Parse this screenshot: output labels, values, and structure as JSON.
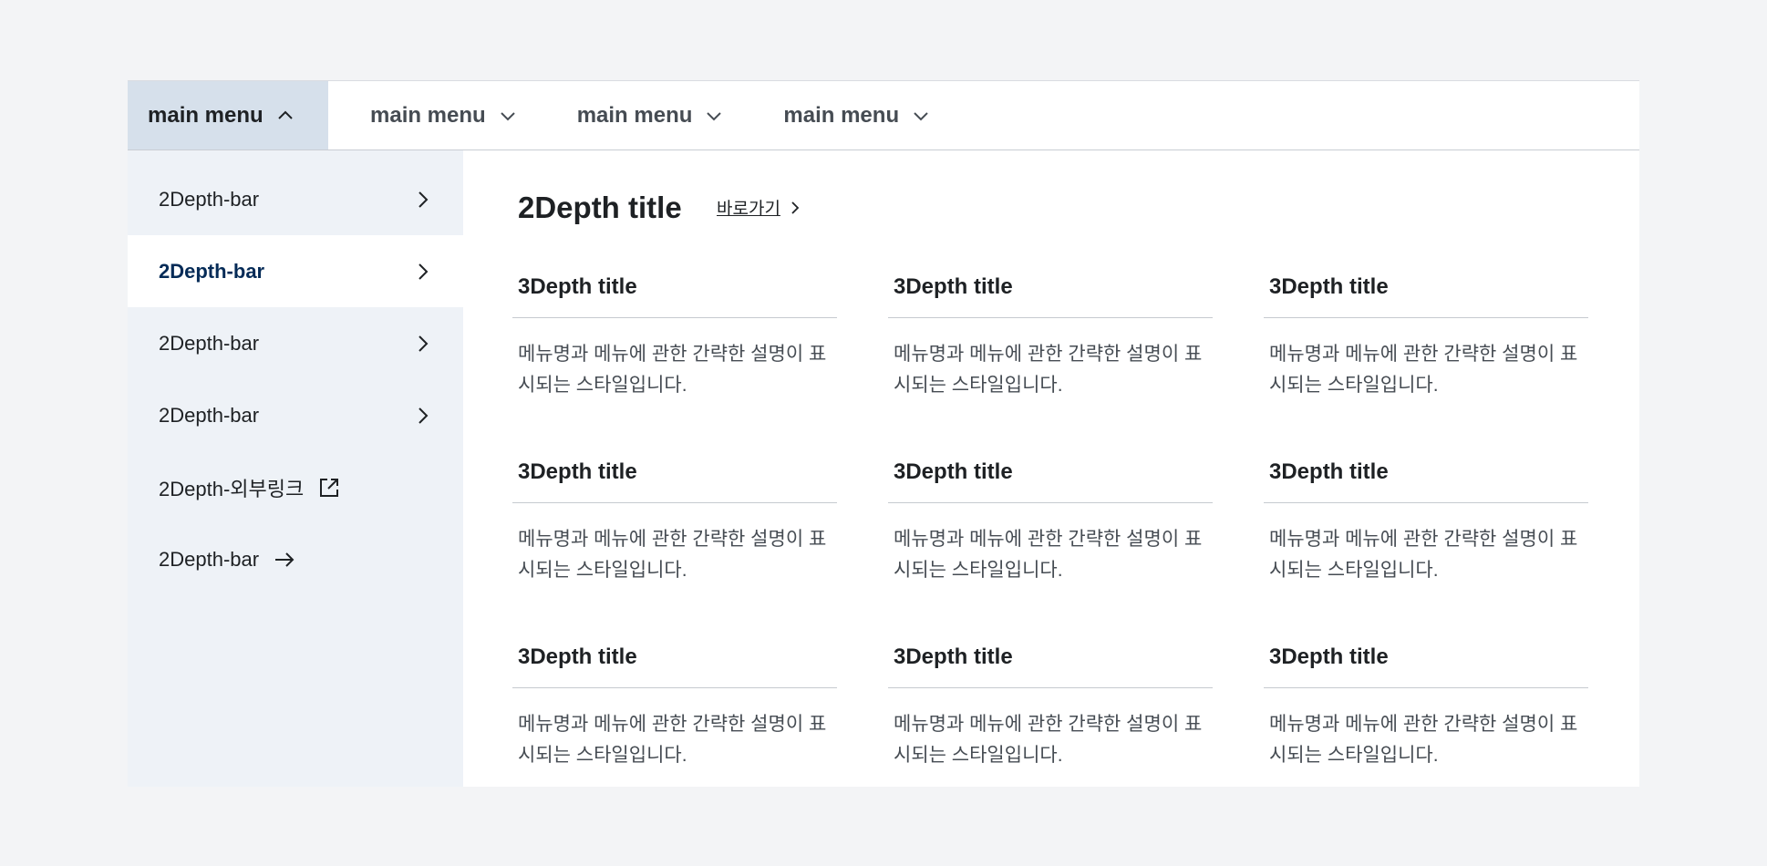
{
  "topnav": {
    "items": [
      {
        "label": "main menu",
        "active": true
      },
      {
        "label": "main menu",
        "active": false
      },
      {
        "label": "main menu",
        "active": false
      },
      {
        "label": "main menu",
        "active": false
      }
    ]
  },
  "side": {
    "items": [
      {
        "label": "2Depth-bar",
        "icon": "chevron-right-icon"
      },
      {
        "label": "2Depth-bar",
        "icon": "chevron-right-icon",
        "active": true
      },
      {
        "label": "2Depth-bar",
        "icon": "chevron-right-icon"
      },
      {
        "label": "2Depth-bar",
        "icon": "chevron-right-icon"
      },
      {
        "label": "2Depth-외부링크",
        "icon": "external-link-icon"
      },
      {
        "label": "2Depth-bar",
        "icon": "arrow-right-icon"
      }
    ]
  },
  "content": {
    "title": "2Depth title",
    "link_label": "바로가기",
    "cards": [
      {
        "title": "3Depth title",
        "desc": "메뉴명과 메뉴에 관한 간략한 설명이 표시되는 스타일입니다."
      },
      {
        "title": "3Depth title",
        "desc": "메뉴명과 메뉴에 관한 간략한 설명이 표시되는 스타일입니다."
      },
      {
        "title": "3Depth title",
        "desc": "메뉴명과 메뉴에 관한 간략한 설명이 표시되는 스타일입니다."
      },
      {
        "title": "3Depth title",
        "desc": "메뉴명과 메뉴에 관한 간략한 설명이 표시되는 스타일입니다."
      },
      {
        "title": "3Depth title",
        "desc": "메뉴명과 메뉴에 관한 간략한 설명이 표시되는 스타일입니다."
      },
      {
        "title": "3Depth title",
        "desc": "메뉴명과 메뉴에 관한 간략한 설명이 표시되는 스타일입니다."
      },
      {
        "title": "3Depth title",
        "desc": "메뉴명과 메뉴에 관한 간략한 설명이 표시되는 스타일입니다."
      },
      {
        "title": "3Depth title",
        "desc": "메뉴명과 메뉴에 관한 간략한 설명이 표시되는 스타일입니다."
      },
      {
        "title": "3Depth title",
        "desc": "메뉴명과 메뉴에 관한 간략한 설명이 표시되는 스타일입니다."
      }
    ]
  },
  "colors": {
    "active_tab_bg": "#d6e0eb",
    "side_bg": "#eef2f7",
    "active_side_text": "#052b57",
    "page_bg": "#f3f4f6"
  }
}
